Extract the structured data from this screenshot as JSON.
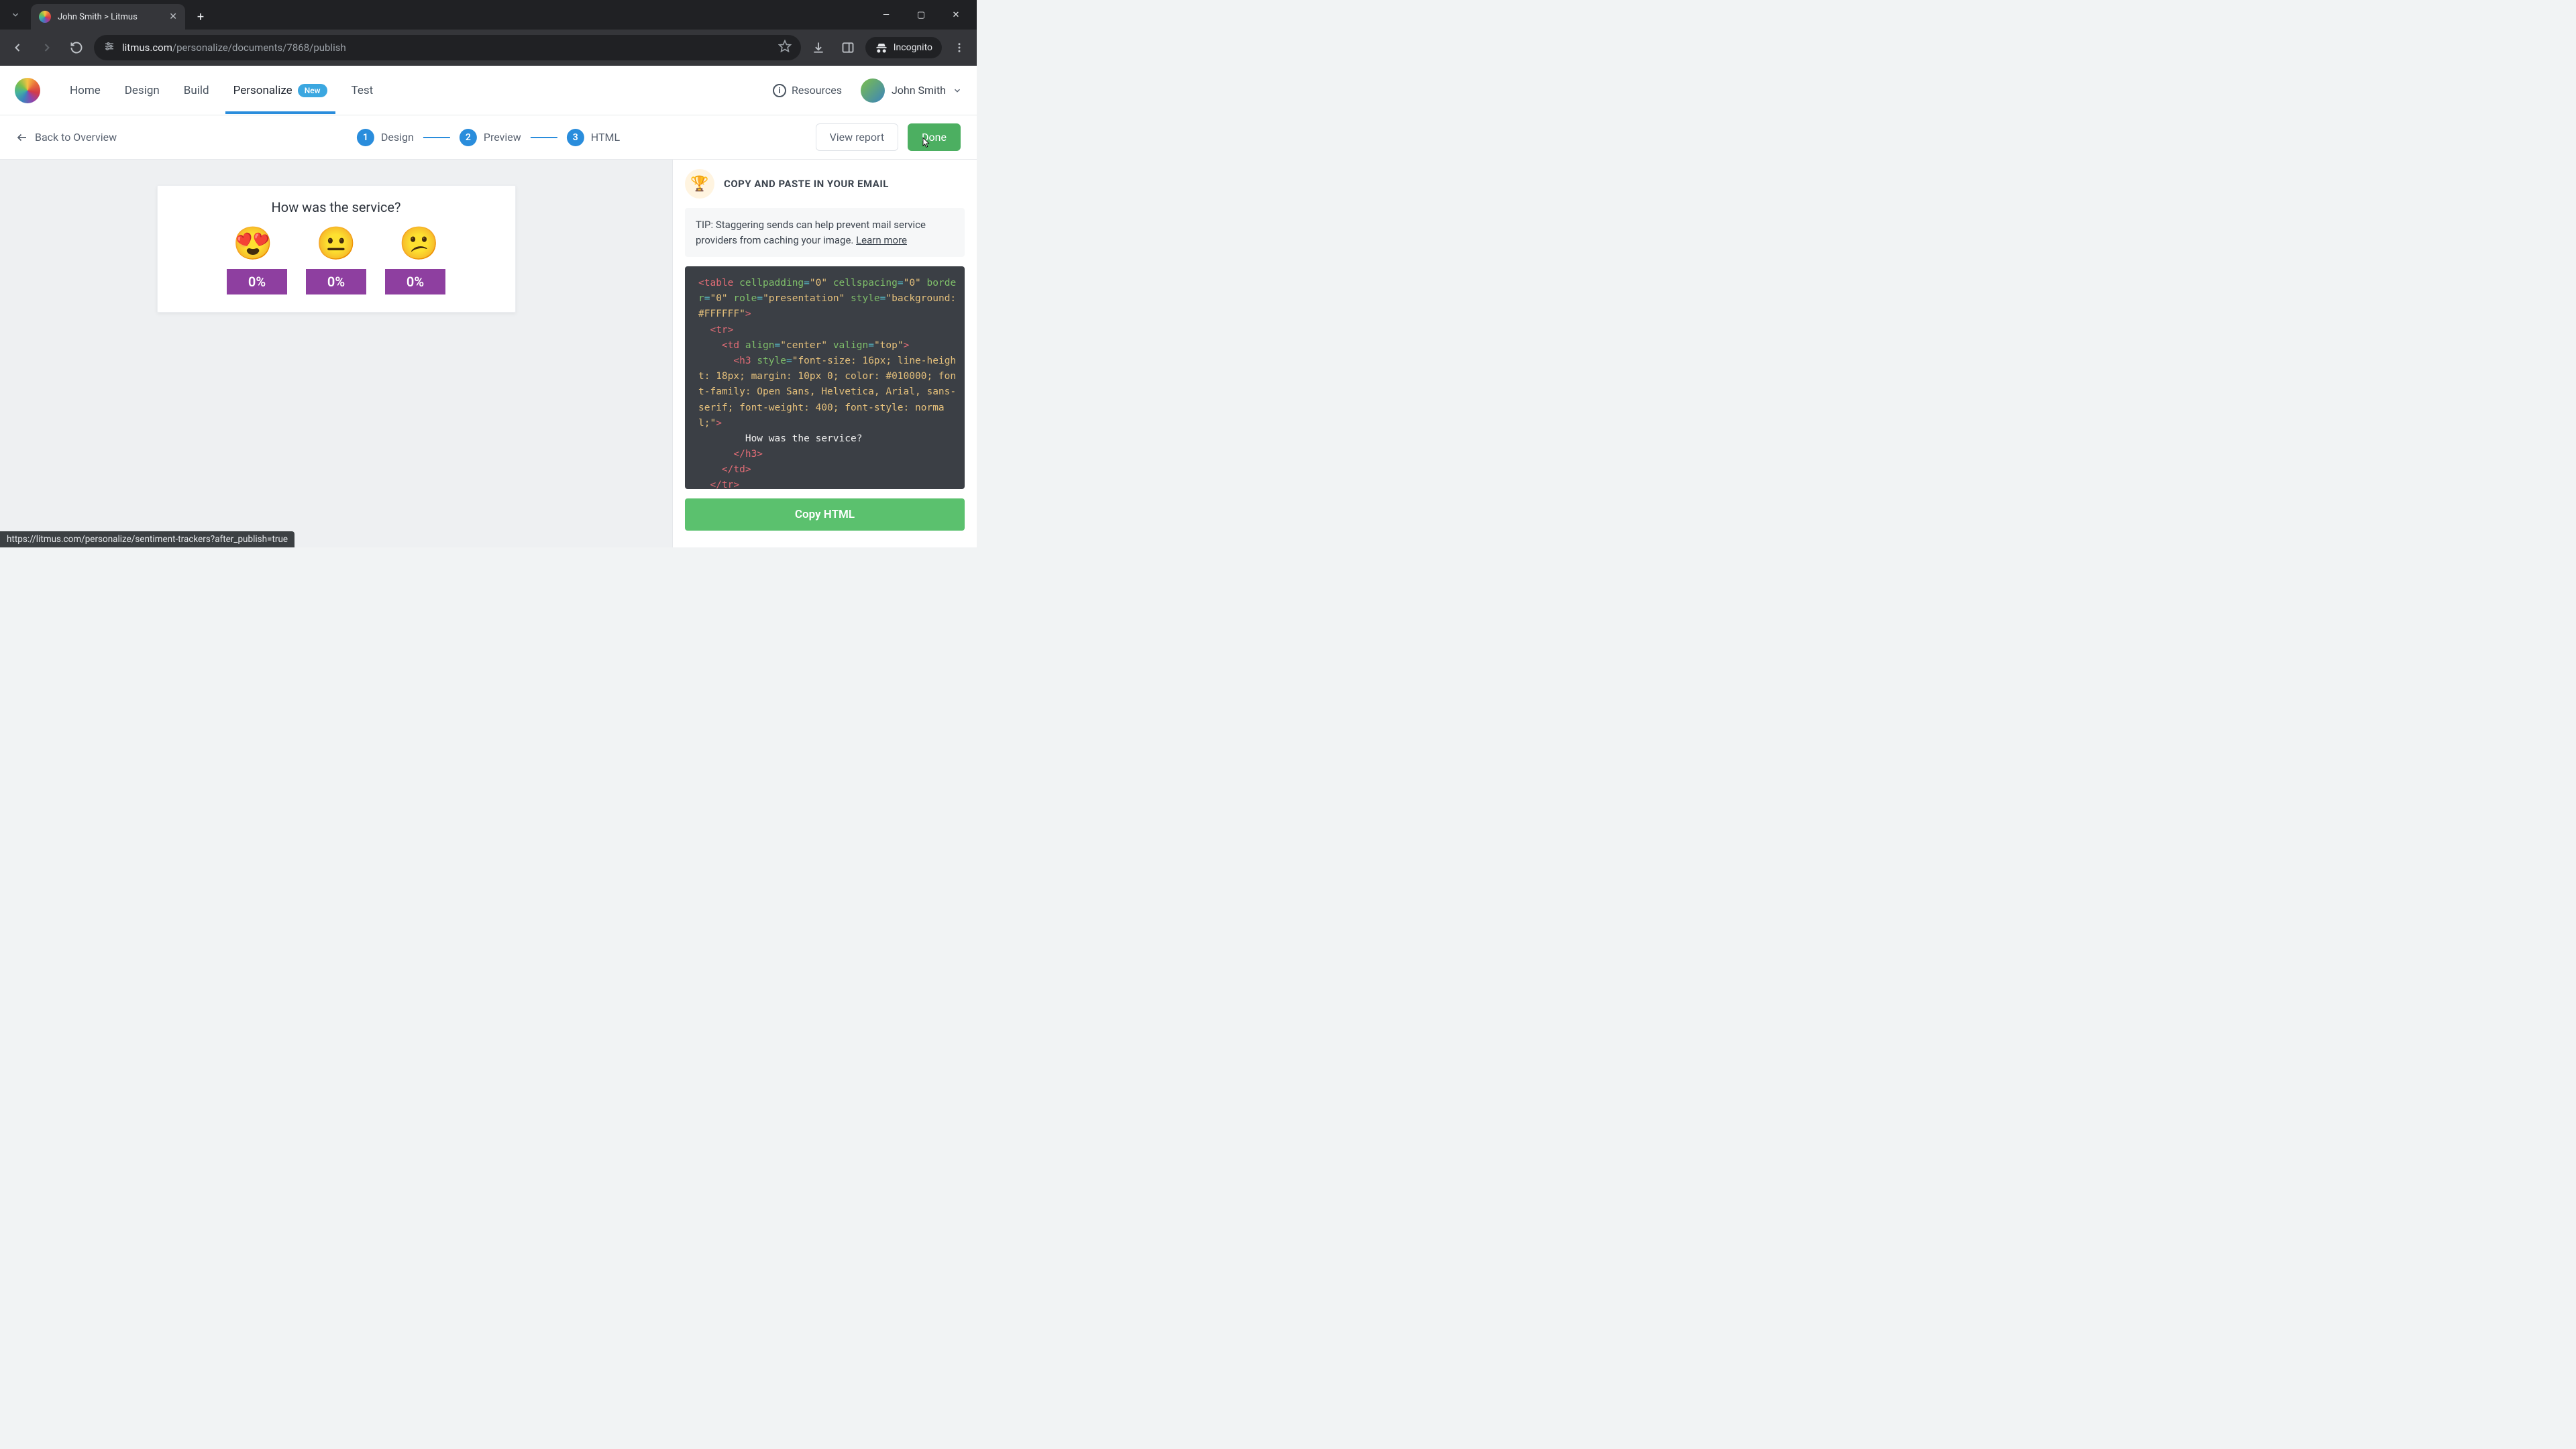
{
  "browser": {
    "tab_title": "John Smith > Litmus",
    "url_host": "litmus.com",
    "url_path": "/personalize/documents/7868/publish",
    "incognito_label": "Incognito",
    "link_preview": "https://litmus.com/personalize/sentiment-trackers?after_publish=true"
  },
  "nav": {
    "items": [
      "Home",
      "Design",
      "Build",
      "Personalize",
      "Test"
    ],
    "active_index": 3,
    "badge_new": "New",
    "resources": "Resources",
    "user_name": "John Smith"
  },
  "subheader": {
    "back_label": "Back to Overview",
    "steps": [
      {
        "num": "1",
        "label": "Design"
      },
      {
        "num": "2",
        "label": "Preview"
      },
      {
        "num": "3",
        "label": "HTML"
      }
    ],
    "view_report": "View report",
    "done": "Done"
  },
  "survey": {
    "title": "How was the service?",
    "options": [
      {
        "emoji": "😍",
        "pct": "0%"
      },
      {
        "emoji": "😐",
        "pct": "0%"
      },
      {
        "emoji": "😕",
        "pct": "0%"
      }
    ]
  },
  "panel": {
    "title": "COPY AND PASTE IN YOUR EMAIL",
    "tip_prefix": "TIP: ",
    "tip_text": "Staggering sends can help prevent mail service providers from caching your image. ",
    "tip_link": "Learn more",
    "copy_btn": "Copy HTML"
  },
  "code": {
    "l1_tag_open": "<table",
    "l1_attr1": " cellpadding",
    "l1_eq": "=",
    "l1_v1": "\"0\"",
    "l1_attr2": " cellspacing",
    "l1_v2": "\"0\"",
    "l2_attr1": " border",
    "l2_v1": "\"0\"",
    "l2_attr2": " role",
    "l2_v2": "\"presentation\"",
    "l3_attr1": " style",
    "l3_v1": "\"background: #FFFFFF\"",
    "l3_close": ">",
    "l4_tr_open": "<tr>",
    "l5_td_open": "<td",
    "l5_attr1": " align",
    "l5_v1": "\"center\"",
    "l5_attr2": " valign",
    "l5_v2": "\"top\"",
    "l5_close": ">",
    "l6_h3_open": "<h3",
    "l6_attr1": " style",
    "l6_v1": "\"font-size: 16px; line-height: 18px; margin: 10px 0; color: #010000; font-family: Open Sans, Helvetica, Arial, sans-serif; font-weight: 400; font-style: normal;\"",
    "l6_close": ">",
    "l7_text": "How was the service?",
    "l8_h3_close": "</h3>",
    "l9_td_close": "</td>",
    "l10_tr_close": "</tr>"
  }
}
